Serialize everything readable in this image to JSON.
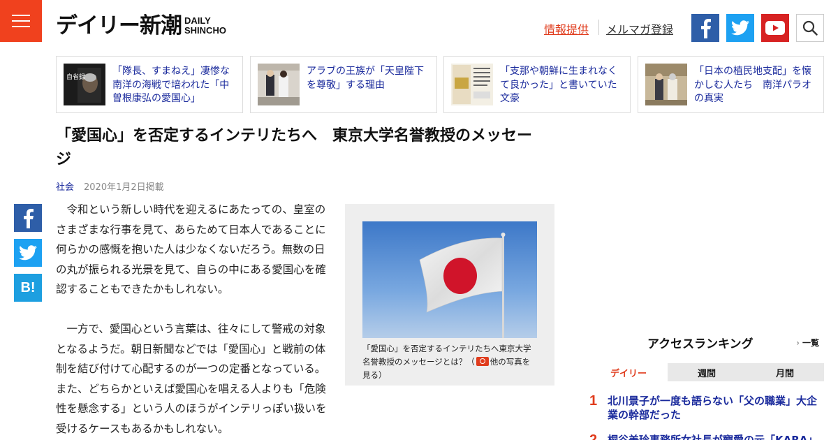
{
  "header": {
    "logo_jp": "デイリー新潮",
    "logo_en_line1": "DAILY",
    "logo_en_line2": "SHINCHO",
    "link_info": "情報提供",
    "link_mail": "メルマガ登録"
  },
  "related": [
    {
      "text": "「隊長、すまねえ」凄惨な南洋の海戦で培われた「中曽根康弘の愛国心」",
      "thumb_text": "自省録"
    },
    {
      "text": "アラブの王族が「天皇陛下を尊敬」する理由"
    },
    {
      "text": "「支那や朝鮮に生まれなくて良かった」と書いていた文豪"
    },
    {
      "text": "「日本の植民地支配」を懐かしむ人たち　南洋パラオの真実"
    }
  ],
  "article": {
    "title": "「愛国心」を否定するインテリたちへ　東京大学名誉教授のメッセージ",
    "category": "社会",
    "date": "2020年1月2日掲載",
    "paragraphs": [
      "令和という新しい時代を迎えるにあたっての、皇室のさまざまな行事を見て、あらためて日本人であることに何らかの感慨を抱いた人は少なくないだろう。無数の日の丸が振られる光景を見て、自らの中にある愛国心を確認することもできたかもしれない。",
      "一方で、愛国心という言葉は、往々にして警戒の対象となるようだ。朝日新聞などでは「愛国心」と戦前の体制を結び付けて心配するのが一つの定番となっている。また、どちらかといえば愛国心を唱える人よりも「危険性を懸念する」という人のほうがインテリっぽい扱いを受けるケースもあるかもしれない。"
    ],
    "caption_main": "「愛国心」を否定するインテリたちへ東京大学名誉教授のメッセージとは？（",
    "caption_link": "他の写真を見る",
    "caption_end": "）"
  },
  "ranking": {
    "title": "アクセスランキング",
    "all_label": "一覧",
    "tabs": [
      "デイリー",
      "週間",
      "月間"
    ],
    "items": [
      {
        "num": "1",
        "text": "北川景子が一度も語らない「父の職業」大企業の幹部だった"
      },
      {
        "num": "2",
        "text": "桐谷美玲事務所女社長が寵愛の元「KARA」ジヨ"
      }
    ]
  },
  "colors": {
    "accent": "#f0411e",
    "link": "#1a2a9c",
    "facebook": "#2e5ea8",
    "twitter": "#1da1f2",
    "youtube": "#d72222"
  }
}
